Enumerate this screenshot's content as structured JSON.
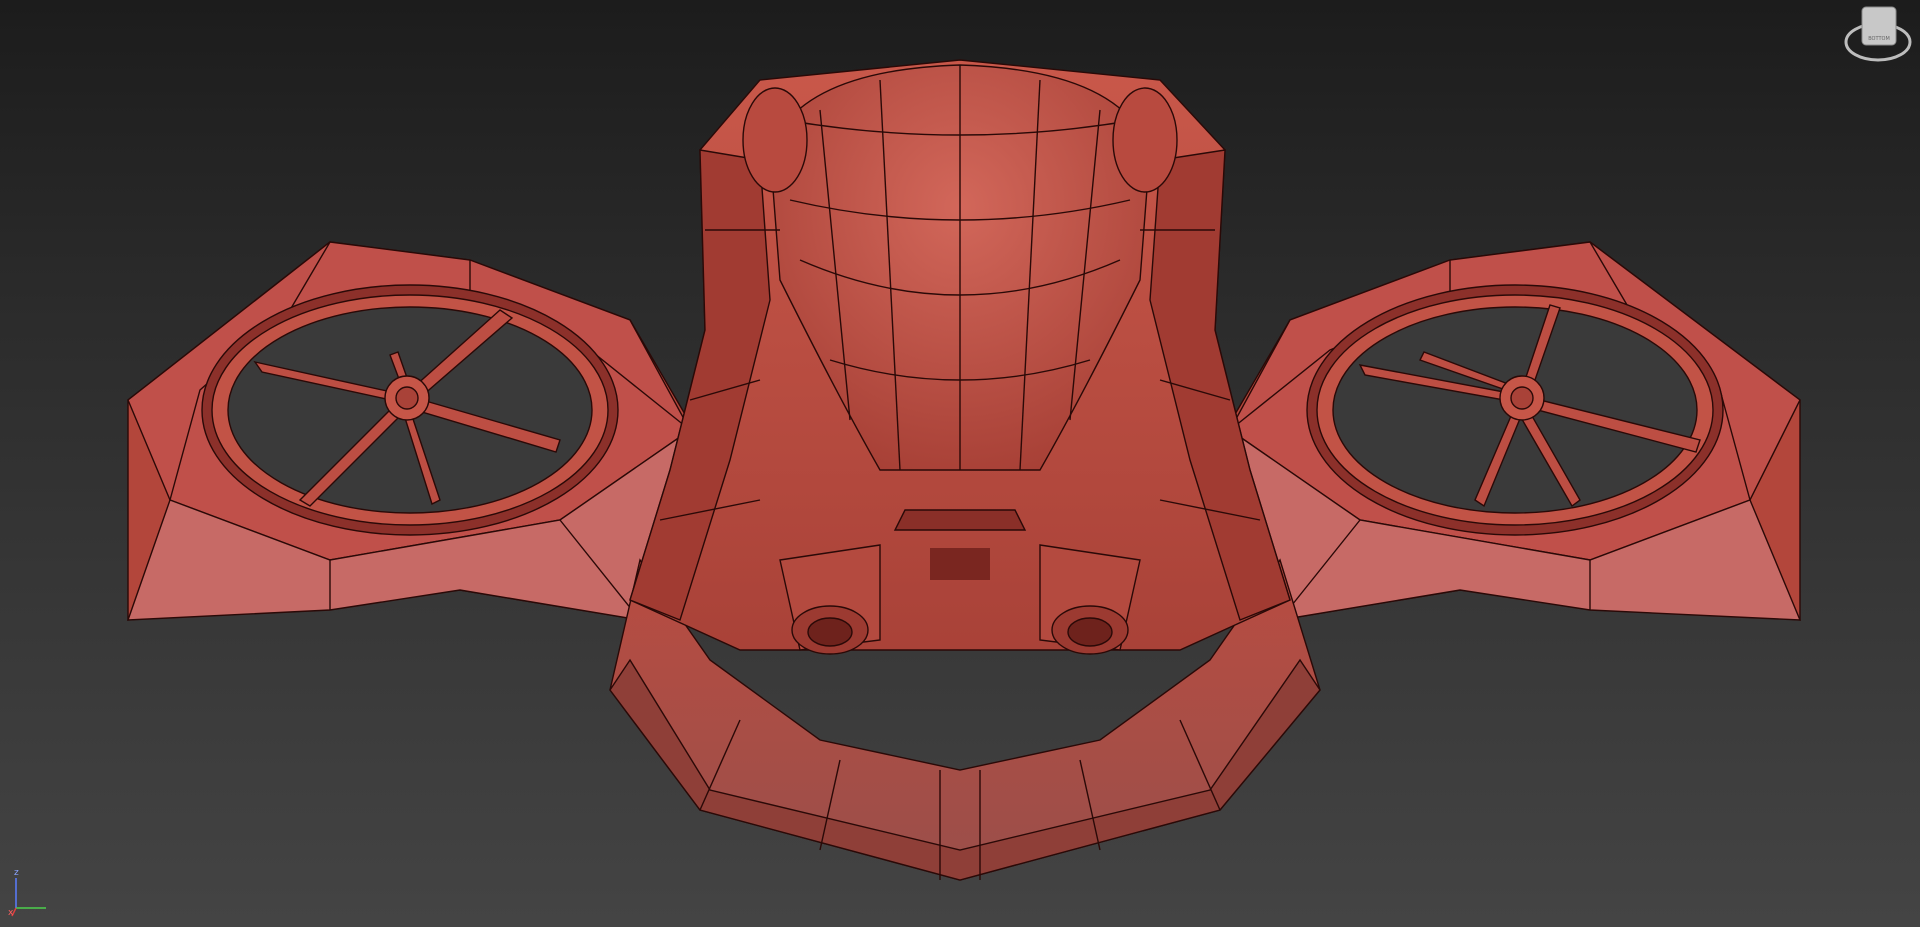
{
  "viewport": {
    "shading": "clay-red-wireframe",
    "background_top": "#1c1c1c",
    "background_bottom": "#444444",
    "mesh_color": "#c25346",
    "wire_color": "#2a0907"
  },
  "viewcube": {
    "face_label": "BOTTOM"
  },
  "axis_gizmo": {
    "z": "z",
    "x": "x"
  }
}
